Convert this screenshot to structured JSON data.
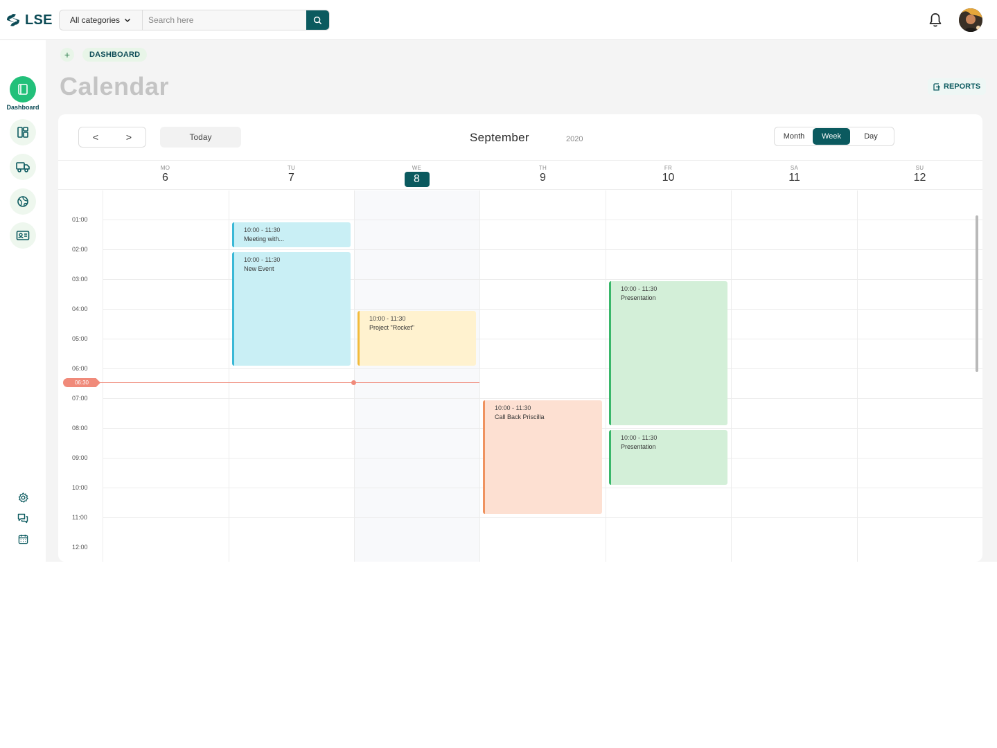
{
  "app": {
    "logo_text": "LSE"
  },
  "header": {
    "category_select": "All categories",
    "search_placeholder": "Search here",
    "icons": [
      "search-icon",
      "bell-icon",
      "avatar"
    ]
  },
  "sidebar": {
    "items": [
      {
        "icon": "book-icon",
        "label": "Dashboard",
        "active": true
      },
      {
        "icon": "layout-icon",
        "label": ""
      },
      {
        "icon": "truck-icon",
        "label": ""
      },
      {
        "icon": "globe-icon",
        "label": ""
      },
      {
        "icon": "id-card-icon",
        "label": ""
      }
    ],
    "bottom_icons": [
      "gear-icon",
      "chat-icon",
      "calendar-icon"
    ]
  },
  "breadcrumb": {
    "item": "DASHBOARD"
  },
  "page": {
    "title": "Calendar",
    "reports_label": "REPORTS"
  },
  "calendar": {
    "nav_prev": "<",
    "nav_next": ">",
    "today_label": "Today",
    "month": "September",
    "year": "2020",
    "views": [
      "Month",
      "Week",
      "Day"
    ],
    "active_view": "Week",
    "days": [
      {
        "name": "MO",
        "num": "6"
      },
      {
        "name": "TU",
        "num": "7"
      },
      {
        "name": "WE",
        "num": "8",
        "today": true
      },
      {
        "name": "TH",
        "num": "9"
      },
      {
        "name": "FR",
        "num": "10"
      },
      {
        "name": "SA",
        "num": "11"
      },
      {
        "name": "SU",
        "num": "12"
      }
    ],
    "times": [
      "01:00",
      "02:00",
      "03:00",
      "04:00",
      "05:00",
      "06:00",
      "07:00",
      "08:00",
      "09:00",
      "10:00",
      "11:00",
      "12:00"
    ],
    "now_label": "06:30",
    "events": [
      {
        "day": "TU",
        "time": "10:00 - 11:30",
        "title": "Meeting with...",
        "color": "#3ab8d6"
      },
      {
        "day": "TU",
        "time": "10:00 - 11:30",
        "title": "New Event",
        "color": "#3ab8d6"
      },
      {
        "day": "WE",
        "time": "10:00 - 11:30",
        "title": "Project \"Rocket\"",
        "color": "#f2bb3c"
      },
      {
        "day": "TH",
        "time": "10:00 - 11:30",
        "title": "Call Back Priscilla",
        "color": "#ef925f"
      },
      {
        "day": "FR",
        "time": "10:00 - 11:30",
        "title": "Presentation",
        "color": "#39b76a"
      },
      {
        "day": "FR",
        "time": "10:00 - 11:30",
        "title": "Presentation",
        "color": "#39b76a"
      }
    ]
  },
  "colors": {
    "brand": "#0b5a5f",
    "accent_green": "#22c07a",
    "now_line": "#f08a7a"
  }
}
